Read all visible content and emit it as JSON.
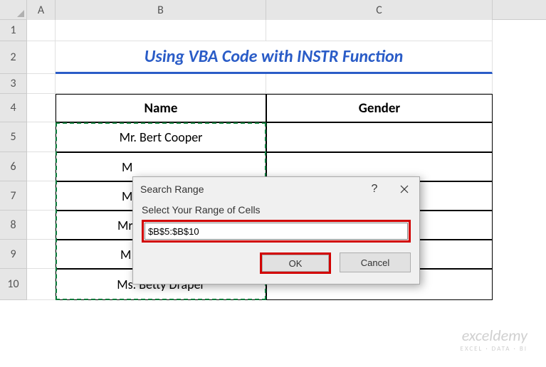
{
  "columns": {
    "A": "A",
    "B": "B",
    "C": "C"
  },
  "rows": {
    "r1": "1",
    "r2": "2",
    "r3": "3",
    "r4": "4",
    "r5": "5",
    "r6": "6",
    "r7": "7",
    "r8": "8",
    "r9": "9",
    "r10": "10"
  },
  "title": "Using VBA Code with INSTR Function",
  "table": {
    "headers": {
      "name": "Name",
      "gender": "Gender"
    },
    "rows": [
      {
        "name": "Mr. Bert Cooper",
        "gender": ""
      },
      {
        "name": "M",
        "gender": ""
      },
      {
        "name": "M",
        "gender": ""
      },
      {
        "name": "Mr",
        "gender": ""
      },
      {
        "name": "M",
        "gender": ""
      },
      {
        "name": "Ms. Betty Draper",
        "gender": ""
      }
    ]
  },
  "dialog": {
    "title": "Search Range",
    "help_label": "?",
    "prompt": "Select Your Range of Cells",
    "input_value": "$B$5:$B$10",
    "ok_label": "OK",
    "cancel_label": "Cancel"
  },
  "watermark": {
    "main": "exceldemy",
    "sub": "EXCEL · DATA · BI"
  }
}
